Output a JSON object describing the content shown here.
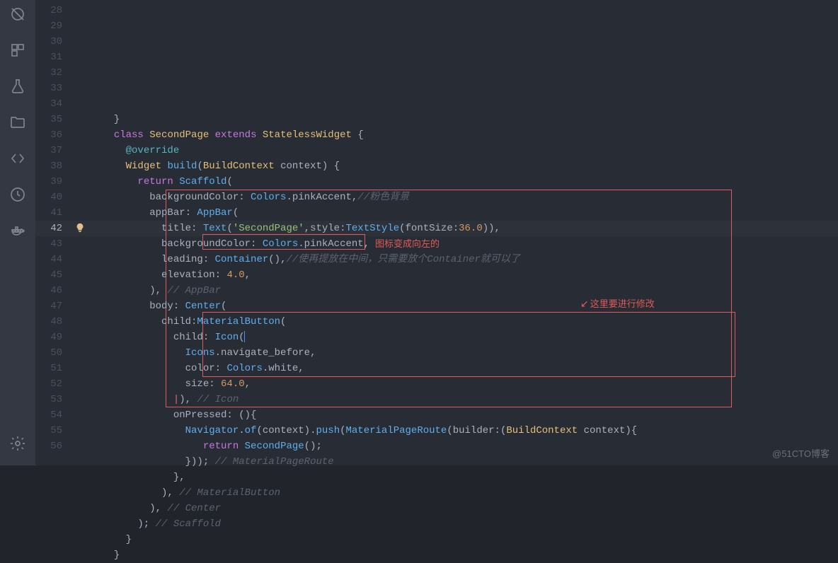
{
  "watermark": "@51CTO博客",
  "sidebar_icons": [
    "debug-icon",
    "extensions-icon",
    "flask-icon",
    "folder-icon",
    "brackets-icon",
    "clock-icon",
    "docker-icon",
    "gear-icon"
  ],
  "annotations": {
    "a1": "图标变成向左的",
    "a2": "这里要进行修改"
  },
  "line_start": 28,
  "current_line": 42,
  "lines": [
    [
      [
        "w",
        "  }"
      ]
    ],
    [
      [
        "w",
        "  "
      ],
      [
        "p",
        "class"
      ],
      [
        "w",
        " "
      ],
      [
        "y",
        "SecondPage"
      ],
      [
        "w",
        " "
      ],
      [
        "p",
        "extends"
      ],
      [
        "w",
        " "
      ],
      [
        "y",
        "StatelessWidget"
      ],
      [
        "w",
        " {"
      ]
    ],
    [
      [
        "w",
        "    "
      ],
      [
        "t",
        "@override"
      ]
    ],
    [
      [
        "w",
        "    "
      ],
      [
        "y",
        "Widget"
      ],
      [
        "w",
        " "
      ],
      [
        "b",
        "build"
      ],
      [
        "w",
        "("
      ],
      [
        "y",
        "BuildContext"
      ],
      [
        "w",
        " context) {"
      ]
    ],
    [
      [
        "w",
        "      "
      ],
      [
        "p",
        "return"
      ],
      [
        "w",
        " "
      ],
      [
        "b",
        "Scaffold"
      ],
      [
        "w",
        "("
      ]
    ],
    [
      [
        "w",
        "        backgroundColor: "
      ],
      [
        "b",
        "Colors"
      ],
      [
        "w",
        ".pinkAccent,"
      ],
      [
        "g",
        "//粉色背景"
      ]
    ],
    [
      [
        "w",
        "        appBar: "
      ],
      [
        "b",
        "AppBar"
      ],
      [
        "w",
        "("
      ]
    ],
    [
      [
        "w",
        "          title: "
      ],
      [
        "b",
        "Text"
      ],
      [
        "w",
        "("
      ],
      [
        "s",
        "'SecondPage'"
      ],
      [
        "w",
        ",style:"
      ],
      [
        "b",
        "TextStyle"
      ],
      [
        "w",
        "(fontSize:"
      ],
      [
        "o",
        "36.0"
      ],
      [
        "w",
        ")),"
      ]
    ],
    [
      [
        "w",
        "          backgroundColor: "
      ],
      [
        "b",
        "Colors"
      ],
      [
        "w",
        ".pinkAccent,"
      ]
    ],
    [
      [
        "w",
        "          leading: "
      ],
      [
        "b",
        "Container"
      ],
      [
        "w",
        "(),"
      ],
      [
        "g",
        "//使再提放在中间，只需要放个Container就可以了"
      ]
    ],
    [
      [
        "w",
        "          elevation: "
      ],
      [
        "o",
        "4.0"
      ],
      [
        "w",
        ","
      ]
    ],
    [
      [
        "w",
        "        ), "
      ],
      [
        "g",
        "// AppBar"
      ]
    ],
    [
      [
        "w",
        "        body: "
      ],
      [
        "b",
        "Center"
      ],
      [
        "w",
        "("
      ]
    ],
    [
      [
        "w",
        "          child:"
      ],
      [
        "b",
        "MaterialButton"
      ],
      [
        "w",
        "("
      ]
    ],
    [
      [
        "w",
        "            child: "
      ],
      [
        "b",
        "Icon"
      ],
      [
        "w",
        "("
      ],
      [
        "caret",
        ""
      ]
    ],
    [
      [
        "w",
        "              "
      ],
      [
        "b",
        "Icons"
      ],
      [
        "w",
        ".navigate_before,"
      ]
    ],
    [
      [
        "w",
        "              color: "
      ],
      [
        "b",
        "Colors"
      ],
      [
        "w",
        ".white,"
      ]
    ],
    [
      [
        "w",
        "              size: "
      ],
      [
        "o",
        "64.0"
      ],
      [
        "w",
        ","
      ]
    ],
    [
      [
        "w",
        "            "
      ],
      [
        "r",
        "|"
      ],
      [
        "w",
        "), "
      ],
      [
        "g",
        "// Icon"
      ]
    ],
    [
      [
        "w",
        "            onPressed: (){"
      ]
    ],
    [
      [
        "w",
        "              "
      ],
      [
        "b",
        "Navigator"
      ],
      [
        "w",
        "."
      ],
      [
        "b",
        "of"
      ],
      [
        "w",
        "(context)."
      ],
      [
        "b",
        "push"
      ],
      [
        "w",
        "("
      ],
      [
        "b",
        "MaterialPageRoute"
      ],
      [
        "w",
        "(builder:("
      ],
      [
        "y",
        "BuildContext"
      ],
      [
        "w",
        " context){"
      ]
    ],
    [
      [
        "w",
        "                 "
      ],
      [
        "p",
        "return"
      ],
      [
        "w",
        " "
      ],
      [
        "b",
        "SecondPage"
      ],
      [
        "w",
        "();"
      ]
    ],
    [
      [
        "w",
        "              })); "
      ],
      [
        "g",
        "// MaterialPageRoute"
      ]
    ],
    [
      [
        "w",
        "            },"
      ]
    ],
    [
      [
        "w",
        "          ), "
      ],
      [
        "g",
        "// MaterialButton"
      ]
    ],
    [
      [
        "w",
        "        ), "
      ],
      [
        "g",
        "// Center"
      ]
    ],
    [
      [
        "w",
        "      ); "
      ],
      [
        "g",
        "// Scaffold"
      ]
    ],
    [
      [
        "w",
        "    }"
      ]
    ],
    [
      [
        "w",
        "  }"
      ]
    ]
  ]
}
